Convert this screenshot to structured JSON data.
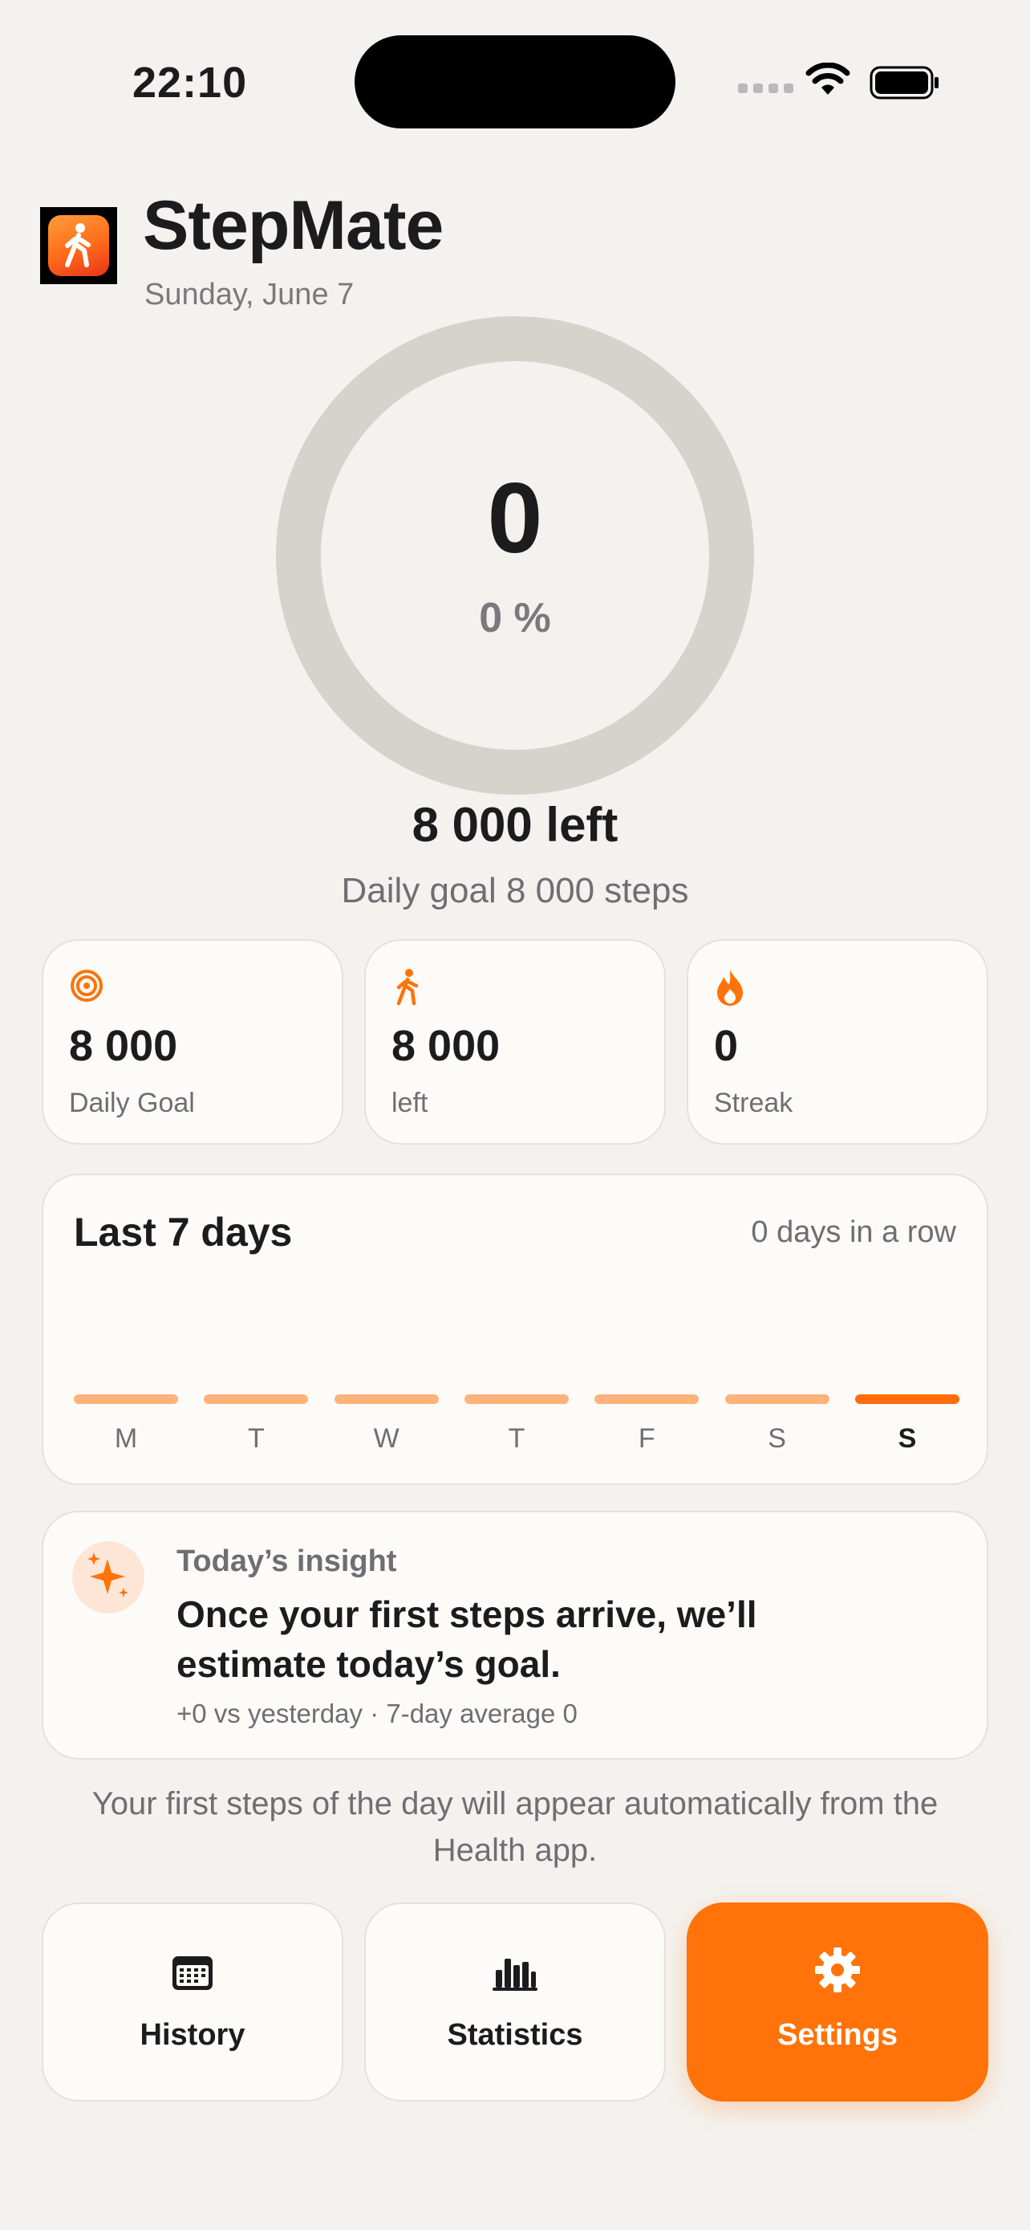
{
  "status_bar": {
    "time": "22:10"
  },
  "header": {
    "title": "StepMate",
    "date": "Sunday, June 7"
  },
  "progress": {
    "steps": "0",
    "percent": "0 %",
    "percent_value": 0,
    "left_label": "8 000 left",
    "goal_label": "Daily goal 8 000 steps"
  },
  "stats": [
    {
      "icon": "target-icon",
      "value": "8 000",
      "label": "Daily Goal"
    },
    {
      "icon": "walking-icon",
      "value": "8 000",
      "label": "left"
    },
    {
      "icon": "flame-icon",
      "value": "0",
      "label": "Streak"
    }
  ],
  "week": {
    "title": "Last 7 days",
    "subtitle": "0 days in a row",
    "days": [
      "M",
      "T",
      "W",
      "T",
      "F",
      "S",
      "S"
    ],
    "today_index": 6
  },
  "insight": {
    "icon": "sparkles-icon",
    "kicker": "Today’s insight",
    "message": "Once your first steps arrive, we’ll estimate today’s goal.",
    "footnote": "+0 vs yesterday · 7-day average 0"
  },
  "note": "Your first steps of the day will appear automatically from the Health app.",
  "nav": {
    "history": "History",
    "statistics": "Statistics",
    "settings": "Settings"
  },
  "colors": {
    "accent": "#ff730a",
    "ring_track": "#d6d3cd",
    "bar_inactive": "#ffb27a",
    "background": "#f4f2ee"
  }
}
